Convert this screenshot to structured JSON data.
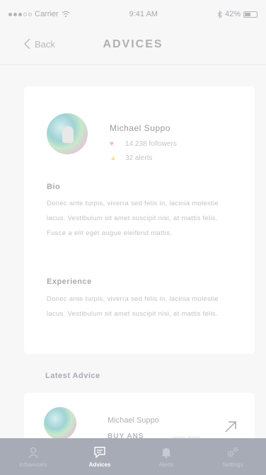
{
  "status_bar": {
    "carrier": "Carrier",
    "time": "9:41 AM",
    "battery": "42%"
  },
  "nav": {
    "back_label": "Back",
    "title": "ADVICES"
  },
  "profile": {
    "name": "Michael Suppo",
    "followers": "14.238 followers",
    "alerts": "32 alerts",
    "bio_title": "Bio",
    "bio_text": "Donec ante turpis, viverra sed felis in, lacinia molestie lacus. Vestibulum sit amet suscipit nisi, at mattis felis. Fusce a elit eget augue eleifend mattis.",
    "experience_title": "Experience",
    "experience_text": "Donec ante turpis, viverra sed felis in, lacinia molestie lacus. Vestibulum sit amet suscipit nisi, at mattis felis."
  },
  "latest_advice": {
    "section_title": "Latest Advice",
    "name": "Michael Suppo",
    "action": "BUY ANS",
    "extra": "—— ——"
  },
  "tabs": [
    {
      "label": "Influencers",
      "icon": "person-icon"
    },
    {
      "label": "Advices",
      "icon": "chat-icon"
    },
    {
      "label": "Alerts",
      "icon": "bell-icon"
    },
    {
      "label": "Settings",
      "icon": "gears-icon"
    }
  ],
  "colors": {
    "tab_bar": "#a7abb6",
    "heart": "#f6b3bd",
    "alert": "#f7e3a3"
  }
}
